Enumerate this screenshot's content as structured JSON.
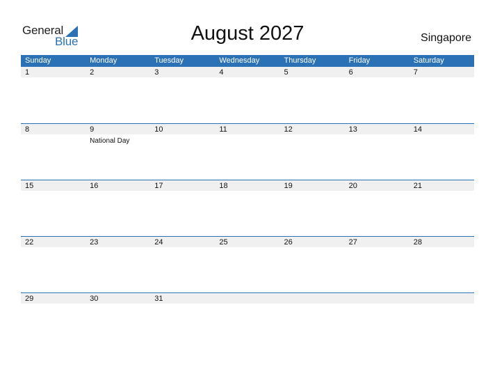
{
  "logo": {
    "text_general": "General",
    "text_blue": "Blue",
    "accent": "#2a72b5"
  },
  "title": "August 2027",
  "country": "Singapore",
  "weekdays": [
    "Sunday",
    "Monday",
    "Tuesday",
    "Wednesday",
    "Thursday",
    "Friday",
    "Saturday"
  ],
  "weeks": [
    {
      "days": [
        {
          "n": "1",
          "e": ""
        },
        {
          "n": "2",
          "e": ""
        },
        {
          "n": "3",
          "e": ""
        },
        {
          "n": "4",
          "e": ""
        },
        {
          "n": "5",
          "e": ""
        },
        {
          "n": "6",
          "e": ""
        },
        {
          "n": "7",
          "e": ""
        }
      ]
    },
    {
      "days": [
        {
          "n": "8",
          "e": ""
        },
        {
          "n": "9",
          "e": "National Day"
        },
        {
          "n": "10",
          "e": ""
        },
        {
          "n": "11",
          "e": ""
        },
        {
          "n": "12",
          "e": ""
        },
        {
          "n": "13",
          "e": ""
        },
        {
          "n": "14",
          "e": ""
        }
      ]
    },
    {
      "days": [
        {
          "n": "15",
          "e": ""
        },
        {
          "n": "16",
          "e": ""
        },
        {
          "n": "17",
          "e": ""
        },
        {
          "n": "18",
          "e": ""
        },
        {
          "n": "19",
          "e": ""
        },
        {
          "n": "20",
          "e": ""
        },
        {
          "n": "21",
          "e": ""
        }
      ]
    },
    {
      "days": [
        {
          "n": "22",
          "e": ""
        },
        {
          "n": "23",
          "e": ""
        },
        {
          "n": "24",
          "e": ""
        },
        {
          "n": "25",
          "e": ""
        },
        {
          "n": "26",
          "e": ""
        },
        {
          "n": "27",
          "e": ""
        },
        {
          "n": "28",
          "e": ""
        }
      ]
    },
    {
      "days": [
        {
          "n": "29",
          "e": ""
        },
        {
          "n": "30",
          "e": ""
        },
        {
          "n": "31",
          "e": ""
        },
        {
          "n": "",
          "e": ""
        },
        {
          "n": "",
          "e": ""
        },
        {
          "n": "",
          "e": ""
        },
        {
          "n": "",
          "e": ""
        }
      ]
    }
  ]
}
